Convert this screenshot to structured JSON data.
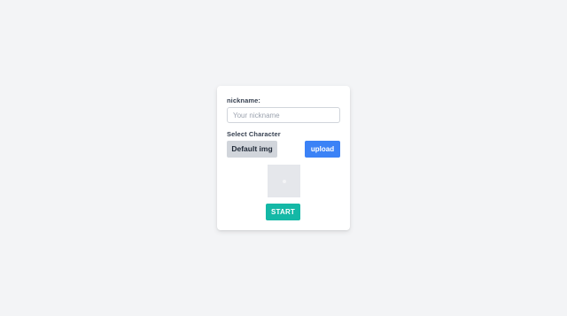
{
  "form": {
    "nickname_label": "nickname:",
    "nickname_placeholder": "Your nickname",
    "nickname_value": "",
    "select_label": "Select Character",
    "default_img_label": "Default img",
    "upload_label": "upload",
    "start_label": "START"
  },
  "colors": {
    "background": "#f3f4f6",
    "upload_button": "#3b82f6",
    "start_button": "#14b8a6",
    "default_button": "#d1d5db"
  },
  "icons": {
    "preview": "image-placeholder-icon"
  }
}
